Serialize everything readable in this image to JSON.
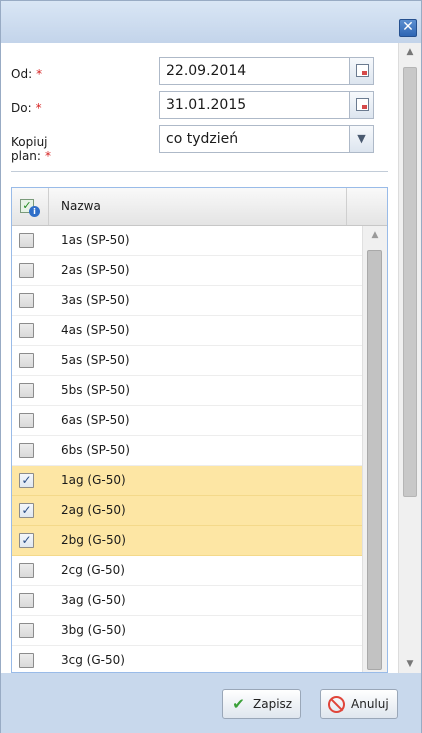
{
  "window": {
    "close_glyph": "✕"
  },
  "form": {
    "from_label": "Od:",
    "from_value": "22.09.2014",
    "to_label": "Do:",
    "to_value": "31.01.2015",
    "copy_label": "Kopiuj plan:",
    "copy_value": "co tydzień",
    "required_marker": "*"
  },
  "grid": {
    "column_name": "Nazwa",
    "rows": [
      {
        "label": "1as (SP-50)",
        "checked": false
      },
      {
        "label": "2as (SP-50)",
        "checked": false
      },
      {
        "label": "3as (SP-50)",
        "checked": false
      },
      {
        "label": "4as (SP-50)",
        "checked": false
      },
      {
        "label": "5as (SP-50)",
        "checked": false
      },
      {
        "label": "5bs (SP-50)",
        "checked": false
      },
      {
        "label": "6as (SP-50)",
        "checked": false
      },
      {
        "label": "6bs (SP-50)",
        "checked": false
      },
      {
        "label": "1ag (G-50)",
        "checked": true
      },
      {
        "label": "2ag (G-50)",
        "checked": true
      },
      {
        "label": "2bg (G-50)",
        "checked": true
      },
      {
        "label": "2cg (G-50)",
        "checked": false
      },
      {
        "label": "3ag (G-50)",
        "checked": false
      },
      {
        "label": "3bg (G-50)",
        "checked": false
      },
      {
        "label": "3cg (G-50)",
        "checked": false
      }
    ]
  },
  "footer": {
    "save_label": "Zapisz",
    "cancel_label": "Anuluj"
  },
  "colors": {
    "selected_row": "#fde6a4",
    "save_icon": "#3aa038",
    "cancel_icon": "#e0453a",
    "close_button": "#2f66b4"
  },
  "icons": {
    "close": "close-icon",
    "calendar": "calendar-icon",
    "dropdown": "chevron-down-icon",
    "header_check": "check-all-icon",
    "save": "checkmark-icon",
    "cancel": "cancel-icon"
  }
}
